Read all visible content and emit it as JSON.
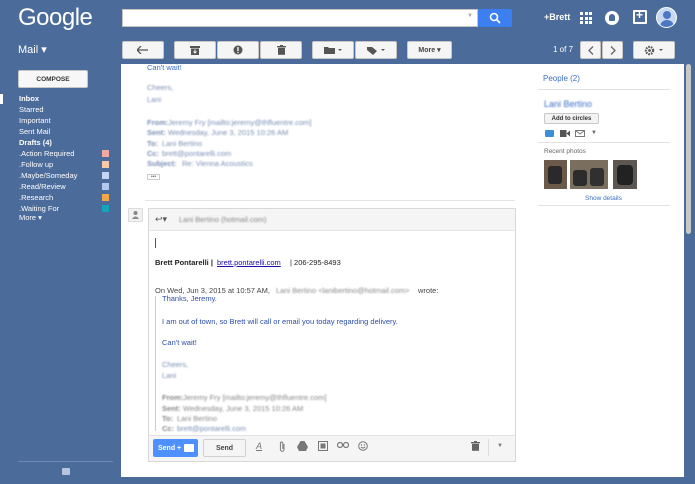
{
  "header": {
    "logo": "Google",
    "user_link": "+Brett"
  },
  "toolbar": {
    "mail_label": "Mail ▾",
    "more_label": "More ▾",
    "pager": "1 of 7"
  },
  "sidebar": {
    "compose_label": "COMPOSE",
    "items": [
      {
        "label": "Inbox",
        "bold": true
      },
      {
        "label": "Starred"
      },
      {
        "label": "Important"
      },
      {
        "label": "Sent Mail"
      },
      {
        "label": "Drafts (4)",
        "bold": true
      },
      {
        "label": ".Action Required",
        "color": "#f4a9a0"
      },
      {
        "label": ".Follow up",
        "color": "#f8c9a9"
      },
      {
        "label": ".Maybe/Someday",
        "color": "#c5d4f0"
      },
      {
        "label": ".Read/Review",
        "color": "#b4c8ec"
      },
      {
        "label": ".Research",
        "color": "#f4a64b"
      },
      {
        "label": ".Waiting For",
        "color": "#16a3b8"
      },
      {
        "label": "More ▾"
      }
    ]
  },
  "quoted_top": {
    "line1": "Can't wait!",
    "cheers": "Cheers,",
    "name": "Lani",
    "from_label": "From:",
    "sent_label": "Sent:",
    "to_label": "To:",
    "cc_label": "Cc:",
    "subject_label": "Subject:",
    "from_val": "Jeremy Fry [mailto:jeremy@thfluentre.com]",
    "sent_val": "Wednesday, June 3, 2015 10:26 AM",
    "to_val": "Lani Bertino",
    "cc_val": "brett@pontarelli.com",
    "subject_val": "Re: Vienna Acoustics",
    "ellipsis": "•••"
  },
  "reply": {
    "to_blurred": "Lani Bertino (hotmail.com)",
    "signature_name": "Brett Pontarelli | ",
    "signature_email": "brett.pontarelli.com",
    "signature_phone": " | 206-295-8493",
    "on_wrote_prefix": "On Wed, Jun 3, 2015 at 10:57 AM,",
    "on_wrote_blurred": "Lani Bertino <lanibertino@hotmail.com>",
    "on_wrote_suffix": "wrote:",
    "thanks": "Thanks, Jeremy.",
    "body": "I am out of town, so Brett will call or email you today regarding delivery.",
    "cant_wait": "Can't wait!",
    "cheers": "Cheers,",
    "name": "Lani",
    "from_label": "From:",
    "sent_label": "Sent:",
    "to_label": "To:",
    "cc_label": "Cc:",
    "from_val": "Jeremy Fry [mailto:jeremy@thfluentre.com]",
    "sent_val": "Wednesday, June 3, 2015 10:26 AM",
    "to_val": "Lani Bertino",
    "cc_val": "brett@pontarelli.com",
    "send_label": "Send +",
    "send_plain_label": "Send"
  },
  "people": {
    "title": "People (2)",
    "contact_name": "Lani Bertino",
    "add_circles": "Add to circles",
    "recent_photos": "Recent photos",
    "show_details": "Show details"
  }
}
